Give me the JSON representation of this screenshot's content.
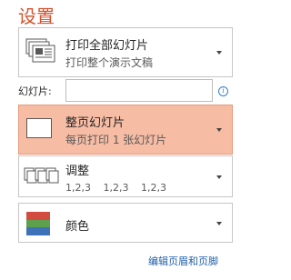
{
  "header": {
    "title": "设置"
  },
  "print_what": {
    "label": "打印全部幻灯片",
    "description": "打印整个演示文稿",
    "icon": "slides-stack-icon"
  },
  "slides": {
    "label": "幻灯片:",
    "value": "",
    "info_icon": "info-icon"
  },
  "layout": {
    "label": "整页幻灯片",
    "description": "每页打印 1 张幻灯片",
    "icon": "full-page-slide-icon",
    "highlight_color": "#f7bca4"
  },
  "collate": {
    "label": "调整",
    "description": "1,2,3    1,2,3    1,2,3",
    "icon": "collate-pages-icon"
  },
  "color": {
    "label": "颜色",
    "icon": "color-swatch-icon",
    "swatch_colors": [
      "#d24c3f",
      "#5fa04e",
      "#3e72b8"
    ]
  },
  "footer": {
    "link_label": "编辑页眉和页脚"
  }
}
